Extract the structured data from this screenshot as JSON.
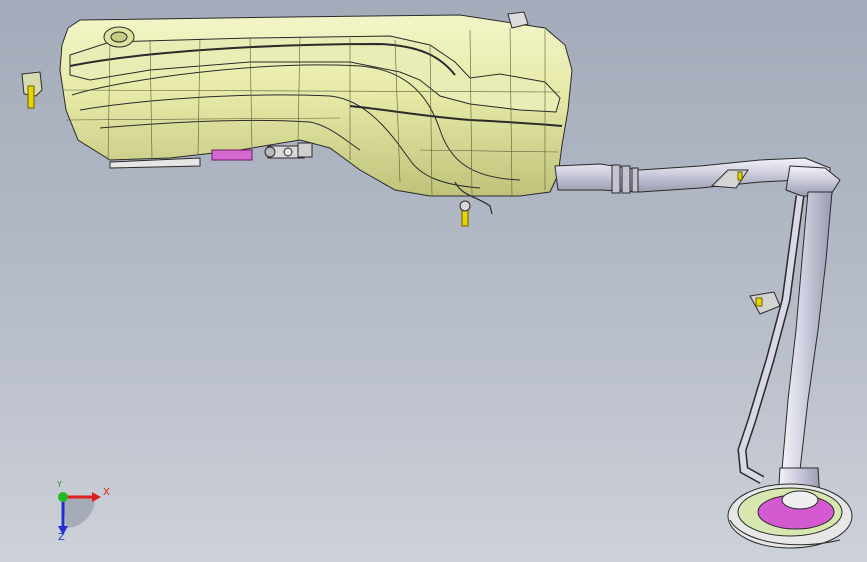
{
  "viewport": {
    "background_top": "#a3abba",
    "background_bottom": "#cdd1d9",
    "model": "fuel-tank-assembly"
  },
  "triad": {
    "x_label": "X",
    "y_label": "Y",
    "z_label": "Z",
    "x_color": "#e02020",
    "y_color": "#1a9a1a",
    "z_color": "#2030d0"
  }
}
